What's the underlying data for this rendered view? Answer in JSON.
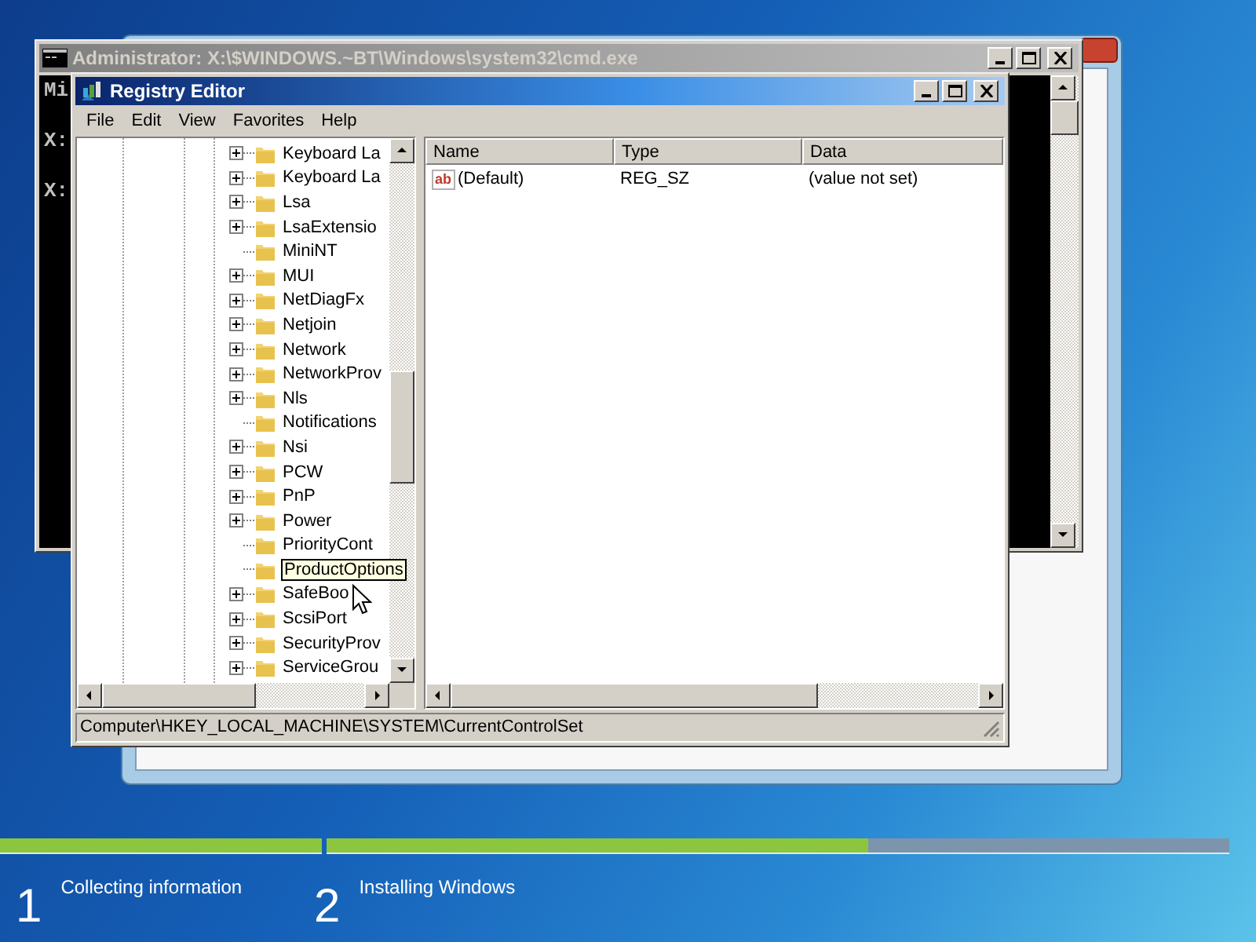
{
  "console_window": {
    "title": "Administrator: X:\\$WINDOWS.~BT\\Windows\\system32\\cmd.exe",
    "active": false,
    "lines": [
      "Mi",
      "X:",
      "X:"
    ]
  },
  "registry_editor": {
    "title": "Registry Editor",
    "active": true,
    "menu": [
      "File",
      "Edit",
      "View",
      "Favorites",
      "Help"
    ],
    "tree": {
      "items": [
        {
          "label": "Keyboard La",
          "expandable": true,
          "hovered": false
        },
        {
          "label": "Keyboard La",
          "expandable": true,
          "hovered": false
        },
        {
          "label": "Lsa",
          "expandable": true,
          "hovered": false
        },
        {
          "label": "LsaExtensio",
          "expandable": true,
          "hovered": false
        },
        {
          "label": "MiniNT",
          "expandable": false,
          "hovered": false
        },
        {
          "label": "MUI",
          "expandable": true,
          "hovered": false
        },
        {
          "label": "NetDiagFx",
          "expandable": true,
          "hovered": false
        },
        {
          "label": "Netjoin",
          "expandable": true,
          "hovered": false
        },
        {
          "label": "Network",
          "expandable": true,
          "hovered": false
        },
        {
          "label": "NetworkProv",
          "expandable": true,
          "hovered": false
        },
        {
          "label": "Nls",
          "expandable": true,
          "hovered": false
        },
        {
          "label": "Notifications",
          "expandable": false,
          "hovered": false
        },
        {
          "label": "Nsi",
          "expandable": true,
          "hovered": false
        },
        {
          "label": "PCW",
          "expandable": true,
          "hovered": false
        },
        {
          "label": "PnP",
          "expandable": true,
          "hovered": false
        },
        {
          "label": "Power",
          "expandable": true,
          "hovered": false
        },
        {
          "label": "PriorityCont",
          "expandable": false,
          "hovered": false
        },
        {
          "label": "ProductOptions",
          "expandable": false,
          "hovered": true
        },
        {
          "label": "SafeBoo",
          "expandable": true,
          "hovered": false
        },
        {
          "label": "ScsiPort",
          "expandable": true,
          "hovered": false
        },
        {
          "label": "SecurityProv",
          "expandable": true,
          "hovered": false
        },
        {
          "label": "ServiceGrou",
          "expandable": true,
          "hovered": false
        }
      ]
    },
    "values": {
      "columns": [
        "Name",
        "Type",
        "Data"
      ],
      "rows": [
        {
          "icon_text": "ab",
          "name": "(Default)",
          "type": "REG_SZ",
          "data": "(value not set)"
        }
      ]
    },
    "status_bar": "Computer\\HKEY_LOCAL_MACHINE\\SYSTEM\\CurrentControlSet"
  },
  "setup_steps": [
    {
      "number": "1",
      "label": "Collecting information",
      "level": 1
    },
    {
      "number": "2",
      "label": "Installing Windows",
      "level": 0.6
    }
  ]
}
